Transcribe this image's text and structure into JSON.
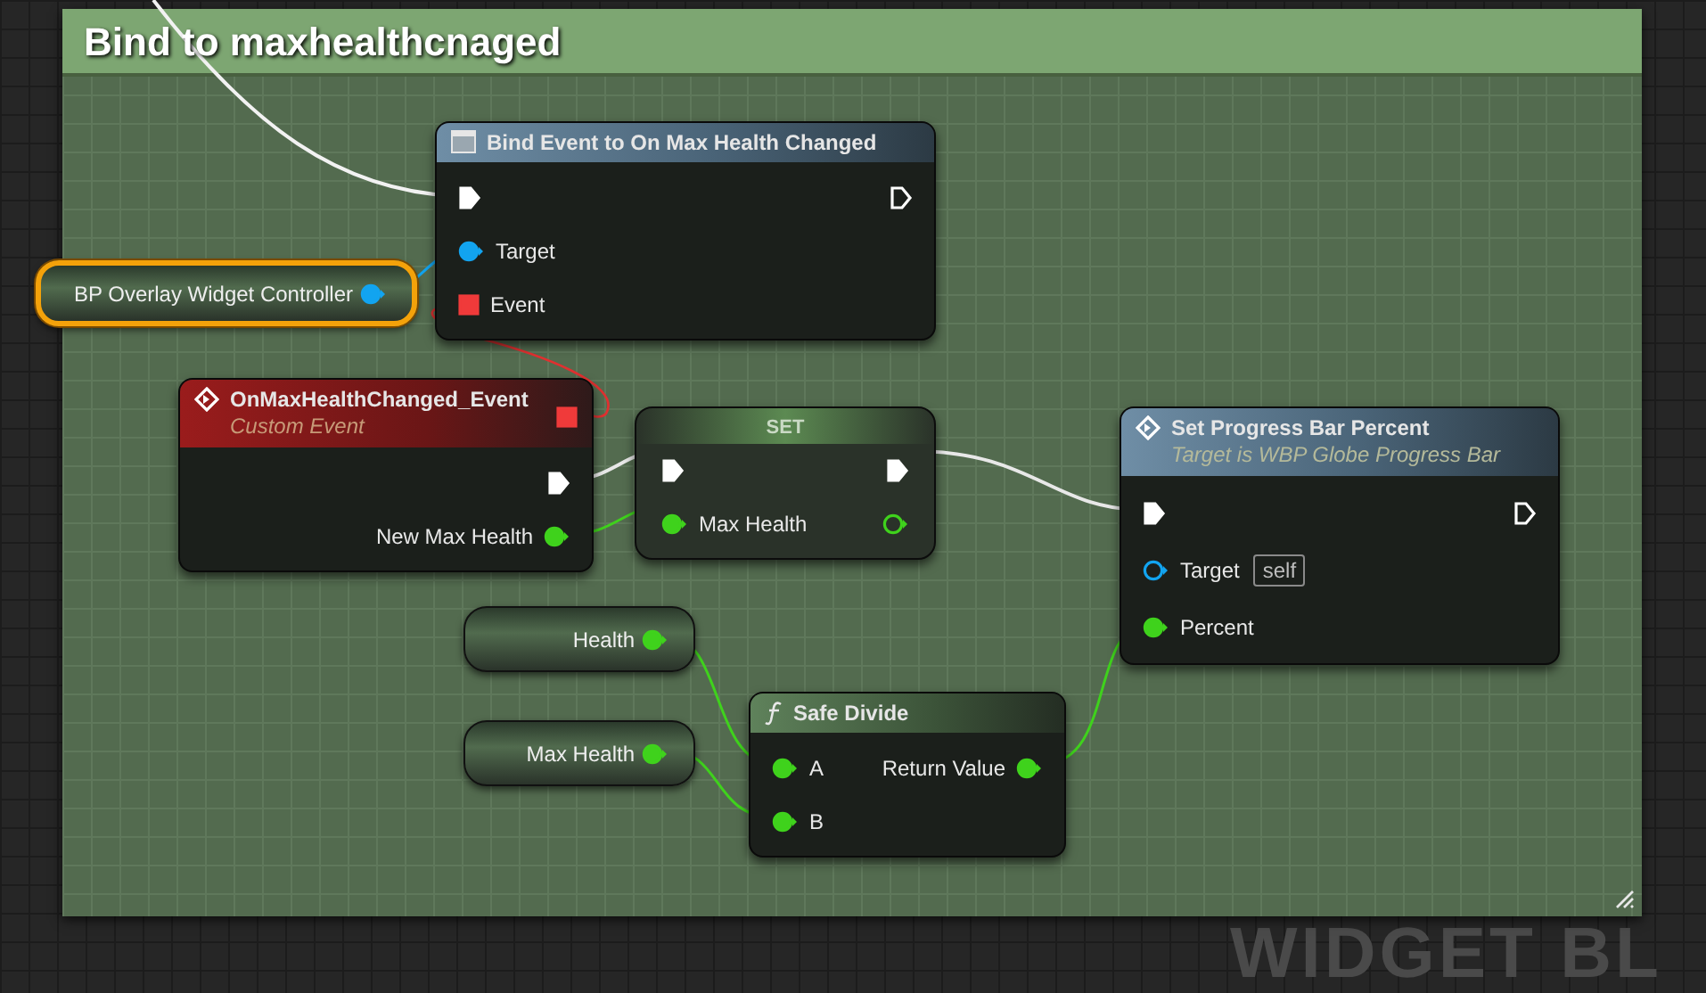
{
  "comment": {
    "title": "Bind to maxhealthcnaged"
  },
  "editor_label": "WIDGET BL",
  "nodes": [
    {
      "kind": "variable",
      "label": "BP Overlay Widget Controller",
      "selected": true,
      "pin": {
        "kind": "object",
        "connected": true
      }
    },
    {
      "kind": "bind",
      "title": "Bind Event to On Max Health Changed",
      "rows": [
        {
          "input": {
            "kind": "exec",
            "connected": true
          },
          "output": {
            "kind": "exec",
            "connected": false
          }
        },
        {
          "input": {
            "kind": "object",
            "label": "Target",
            "connected": true
          }
        },
        {
          "input": {
            "kind": "delegate",
            "label": "Event",
            "connected": true
          }
        }
      ]
    },
    {
      "kind": "event",
      "title": "OnMaxHealthChanged_Event",
      "subtitle": "Custom Event",
      "header_pin": {
        "kind": "delegate",
        "connected": true
      },
      "rows": [
        {
          "output": {
            "kind": "exec",
            "connected": true
          }
        },
        {
          "output": {
            "kind": "float",
            "label": "New Max Health",
            "connected": true
          }
        }
      ]
    },
    {
      "kind": "set",
      "title": "SET",
      "rows": [
        {
          "input": {
            "kind": "exec",
            "connected": true
          },
          "output": {
            "kind": "exec",
            "connected": true
          }
        },
        {
          "input": {
            "kind": "float",
            "label": "Max Health",
            "connected": true
          },
          "output": {
            "kind": "float",
            "connected": false
          }
        }
      ]
    },
    {
      "kind": "function",
      "title": "Set Progress Bar Percent",
      "subtitle": "Target is WBP Globe Progress Bar",
      "rows": [
        {
          "input": {
            "kind": "exec",
            "connected": true
          },
          "output": {
            "kind": "exec",
            "connected": false
          }
        },
        {
          "input": {
            "kind": "object",
            "label": "Target",
            "connected": false,
            "default_value": "self"
          }
        },
        {
          "input": {
            "kind": "float",
            "label": "Percent",
            "connected": true
          }
        }
      ]
    },
    {
      "kind": "variable",
      "label": "Health",
      "selected": false,
      "pin": {
        "kind": "float",
        "connected": true
      }
    },
    {
      "kind": "variable",
      "label": "Max Health",
      "selected": false,
      "pin": {
        "kind": "float",
        "connected": true
      }
    },
    {
      "kind": "pure",
      "title": "Safe Divide",
      "rows": [
        {
          "input": {
            "kind": "float",
            "label": "A",
            "connected": true
          },
          "output": {
            "kind": "float",
            "label": "Return Value",
            "connected": true
          }
        },
        {
          "input": {
            "kind": "float",
            "label": "B",
            "connected": true
          }
        }
      ]
    }
  ]
}
